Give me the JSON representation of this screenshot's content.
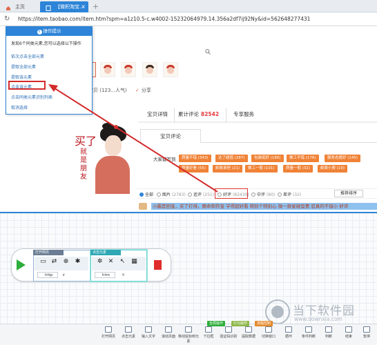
{
  "browser": {
    "tabs": [
      {
        "label": "主页"
      },
      {
        "label": "【微积淘宝..."
      }
    ],
    "url": "https://item.taobao.com/item.htm?spm=a1z10.5-c.w4002-15232064979.14.356a2df7ij92Ny&id=562648277431"
  },
  "popup": {
    "title": "操作提示",
    "description": "发现6个同类元素,您可以选择以下操作",
    "options": [
      "依次点击全部元素",
      "提取全部元素",
      "提取该元素",
      "点击该元素",
      "点击同类元素识别列表",
      "取消选择"
    ]
  },
  "product": {
    "fav": "收藏宝贝 (123...人气)",
    "share": "分享",
    "image_title": "买了",
    "image_sub": "就是朋友"
  },
  "product_tabs": {
    "detail": "宝贝详情",
    "review": "累计评论",
    "review_count": "82542",
    "service": "专享服务"
  },
  "review": {
    "tab": "宝贝评论",
    "tags_label": "大家都写到",
    "tags": [
      "质量不错 (343)",
      "达了超值 (287)",
      "包装挺好 (180)",
      "做工不错 (176)",
      "服务态度好 (145)",
      "质量好看 (55)",
      "邮费承担 (21)",
      "做工一般 (101)",
      "质量一般 (32)",
      "邮费小费 (19)"
    ],
    "filters": [
      {
        "label": "全部",
        "count": ""
      },
      {
        "label": "图片",
        "count": "(2783)"
      },
      {
        "label": "追评",
        "count": "(251)"
      },
      {
        "label": "好评",
        "count": "(82430)"
      },
      {
        "label": "中评",
        "count": "(80)"
      },
      {
        "label": "差评",
        "count": "(32)"
      }
    ],
    "sort": "推荐排序",
    "first_text": "小霸是回宝，买了打排，赠命和符宝 学得超好看 特别个特别心 微一款星碰型费 忍真的不错小 好评 "
  },
  "flow": {
    "module1_title": "打开网页",
    "module2_title": "点击元素",
    "module1_foot": "http",
    "module2_foot": "htm"
  },
  "toolbar": {
    "items": [
      "打开网页",
      "点击元素",
      "输入文字",
      "滚动页面",
      "移动鼠标到元素",
      "下拉框",
      "验证码识别",
      "提取数据",
      "切换窗口",
      "循环",
      "条件判断",
      "判断",
      "结束",
      "暂停",
      "其他"
    ],
    "tags": [
      "全局操作",
      "行为操作",
      "流程控制"
    ]
  },
  "watermark": {
    "text": "当下软件园",
    "url": "www.downxia.com"
  },
  "colors": {
    "accent": "#2d84d8",
    "tag": "#f08236",
    "highlight_red": "#d32a2a",
    "play": "#2fae3b",
    "stop": "#e02b2b"
  }
}
